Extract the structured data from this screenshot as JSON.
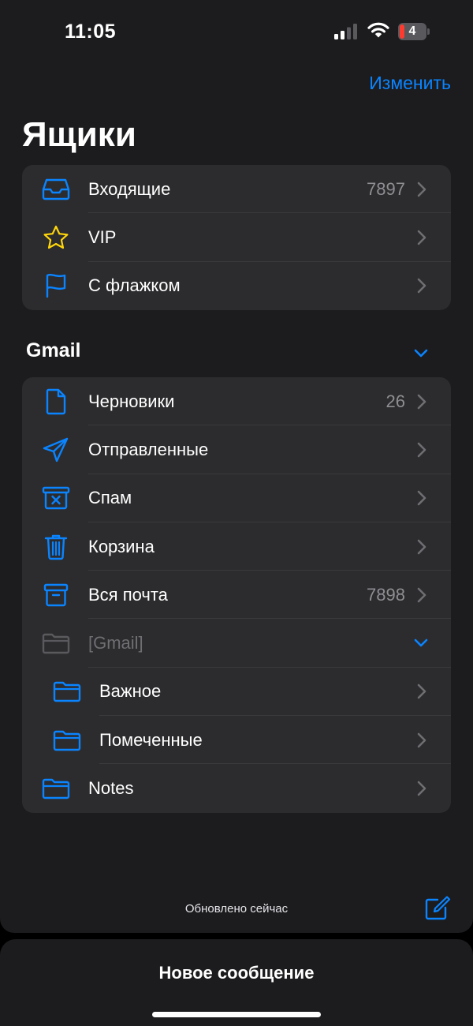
{
  "status_bar": {
    "time": "11:05",
    "battery_level": "4",
    "icons": [
      "signal-icon",
      "wifi-icon",
      "battery-icon"
    ]
  },
  "header": {
    "edit_label": "Изменить",
    "title": "Ящики"
  },
  "mailboxes": [
    {
      "label": "Входящие",
      "count": "7897",
      "icon": "inbox-icon"
    },
    {
      "label": "VIP",
      "count": "",
      "icon": "star-icon"
    },
    {
      "label": "С флажком",
      "count": "",
      "icon": "flag-icon"
    }
  ],
  "gmail_section": {
    "title": "Gmail",
    "items": [
      {
        "label": "Черновики",
        "count": "26",
        "icon": "document-icon"
      },
      {
        "label": "Отправленные",
        "count": "",
        "icon": "paper-plane-icon"
      },
      {
        "label": "Спам",
        "count": "",
        "icon": "junk-icon"
      },
      {
        "label": "Корзина",
        "count": "",
        "icon": "trash-icon"
      },
      {
        "label": "Вся почта",
        "count": "7898",
        "icon": "archive-icon"
      },
      {
        "label": "[Gmail]",
        "count": "",
        "icon": "folder-icon"
      },
      {
        "label": "Важное",
        "count": "",
        "icon": "folder-icon"
      },
      {
        "label": "Помеченные",
        "count": "",
        "icon": "folder-icon"
      },
      {
        "label": "Notes",
        "count": "",
        "icon": "folder-icon"
      }
    ]
  },
  "footer": {
    "status": "Обновлено сейчас"
  },
  "bottom_sheet": {
    "title": "Новое сообщение"
  },
  "colors": {
    "accent": "#0a84ff",
    "star": "#ffd60a",
    "background": "#1c1c1e",
    "cell": "#2c2c2e",
    "secondary_text": "#8e8e93",
    "battery_low": "#ff3b30"
  }
}
